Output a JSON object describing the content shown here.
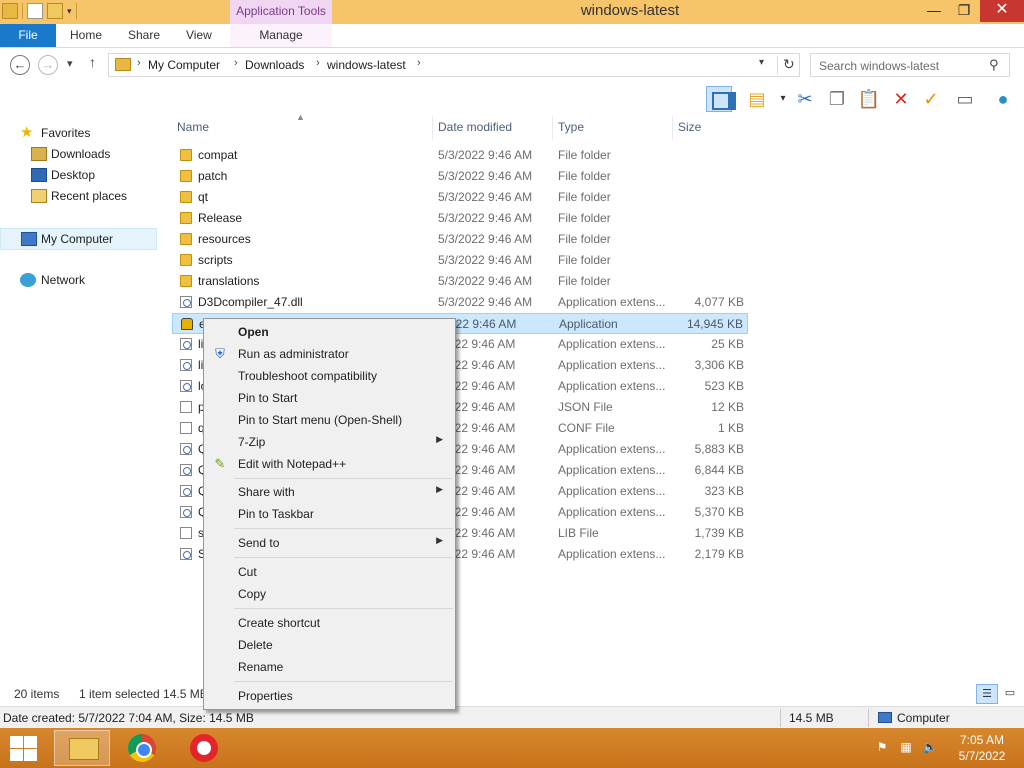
{
  "window": {
    "title": "windows-latest",
    "context_tab": "Application Tools",
    "min_glyph": "—",
    "max_glyph": "❐",
    "close_glyph": "✕"
  },
  "ribbon": {
    "file": "File",
    "tabs": [
      "Home",
      "Share",
      "View",
      "Manage"
    ]
  },
  "address": {
    "crumbs": [
      "My Computer",
      "Downloads",
      "windows-latest"
    ],
    "search_placeholder": "Search windows-latest"
  },
  "nav": {
    "favorites": "Favorites",
    "items": [
      "Downloads",
      "Desktop",
      "Recent places"
    ],
    "computer": "My Computer",
    "network": "Network"
  },
  "columns": [
    "Name",
    "Date modified",
    "Type",
    "Size"
  ],
  "files": [
    {
      "name": "compat",
      "date": "5/3/2022 9:46 AM",
      "type": "File folder",
      "size": "",
      "icon": "folder"
    },
    {
      "name": "patch",
      "date": "5/3/2022 9:46 AM",
      "type": "File folder",
      "size": "",
      "icon": "folder"
    },
    {
      "name": "qt",
      "date": "5/3/2022 9:46 AM",
      "type": "File folder",
      "size": "",
      "icon": "folder"
    },
    {
      "name": "Release",
      "date": "5/3/2022 9:46 AM",
      "type": "File folder",
      "size": "",
      "icon": "folder"
    },
    {
      "name": "resources",
      "date": "5/3/2022 9:46 AM",
      "type": "File folder",
      "size": "",
      "icon": "folder"
    },
    {
      "name": "scripts",
      "date": "5/3/2022 9:46 AM",
      "type": "File folder",
      "size": "",
      "icon": "folder"
    },
    {
      "name": "translations",
      "date": "5/3/2022 9:46 AM",
      "type": "File folder",
      "size": "",
      "icon": "folder"
    },
    {
      "name": "D3Dcompiler_47.dll",
      "date": "5/3/2022 9:46 AM",
      "type": "Application extens...",
      "size": "4,077 KB",
      "icon": "dll"
    },
    {
      "name": "e",
      "date": "/2022 9:46 AM",
      "type": "Application",
      "size": "14,945 KB",
      "icon": "app",
      "selected": true
    },
    {
      "name": "li",
      "date": "/2022 9:46 AM",
      "type": "Application extens...",
      "size": "25 KB",
      "icon": "dll"
    },
    {
      "name": "li",
      "date": "/2022 9:46 AM",
      "type": "Application extens...",
      "size": "3,306 KB",
      "icon": "dll"
    },
    {
      "name": "lo",
      "date": "/2022 9:46 AM",
      "type": "Application extens...",
      "size": "523 KB",
      "icon": "dll"
    },
    {
      "name": "p",
      "date": "/2022 9:46 AM",
      "type": "JSON File",
      "size": "12 KB",
      "icon": "doc"
    },
    {
      "name": "q",
      "date": "/2022 9:46 AM",
      "type": "CONF File",
      "size": "1 KB",
      "icon": "doc"
    },
    {
      "name": "Q",
      "date": "/2022 9:46 AM",
      "type": "Application extens...",
      "size": "5,883 KB",
      "icon": "dll"
    },
    {
      "name": "Q",
      "date": "/2022 9:46 AM",
      "type": "Application extens...",
      "size": "6,844 KB",
      "icon": "dll"
    },
    {
      "name": "Q",
      "date": "/2022 9:46 AM",
      "type": "Application extens...",
      "size": "323 KB",
      "icon": "dll"
    },
    {
      "name": "Q",
      "date": "/2022 9:46 AM",
      "type": "Application extens...",
      "size": "5,370 KB",
      "icon": "dll"
    },
    {
      "name": "s",
      "date": "/2022 9:46 AM",
      "type": "LIB File",
      "size": "1,739 KB",
      "icon": "doc"
    },
    {
      "name": "S",
      "date": "/2022 9:46 AM",
      "type": "Application extens...",
      "size": "2,179 KB",
      "icon": "dll"
    }
  ],
  "context_menu": {
    "open": "Open",
    "run_admin": "Run as administrator",
    "troubleshoot": "Troubleshoot compatibility",
    "pin_start": "Pin to Start",
    "pin_start_menu": "Pin to Start menu (Open-Shell)",
    "zip": "7-Zip",
    "notepadpp": "Edit with Notepad++",
    "share_with": "Share with",
    "pin_taskbar": "Pin to Taskbar",
    "send_to": "Send to",
    "cut": "Cut",
    "copy": "Copy",
    "create_shortcut": "Create shortcut",
    "delete": "Delete",
    "rename": "Rename",
    "properties": "Properties"
  },
  "status": {
    "items": "20 items",
    "selected": "1 item selected  14.5 MB"
  },
  "details": {
    "created": "Date created: 5/7/2022 7:04 AM, Size: 14.5 MB",
    "size": "14.5 MB",
    "location": "Computer"
  },
  "clock": {
    "time": "7:05 AM",
    "date": "5/7/2022"
  },
  "colors": {
    "titlebar": "#f6c56a",
    "file_tab": "#1979ca",
    "selection": "#cce8ff",
    "taskbar": "#d8872e"
  }
}
